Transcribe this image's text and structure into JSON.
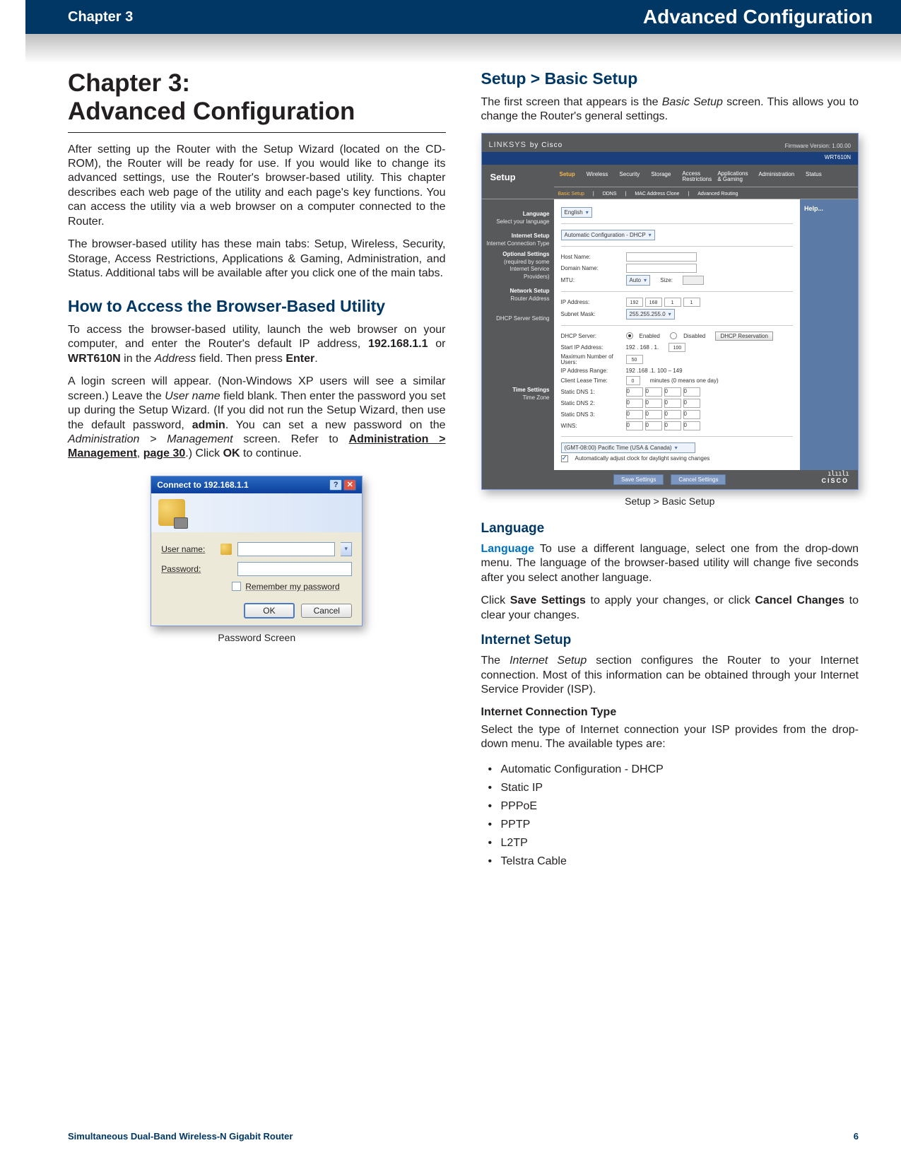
{
  "header": {
    "chapter_label": "Chapter 3",
    "section_title": "Advanced Configuration"
  },
  "left": {
    "title": "Chapter 3:\nAdvanced Configuration",
    "p1": "After setting up the Router with the Setup Wizard (located on the CD-ROM), the Router will be ready for use. If you would like to change its advanced settings, use the Router's browser-based utility. This chapter describes each web page of the utility and each page's key functions. You can access the utility via a web browser on a computer connected to the Router.",
    "p2": "The browser-based utility has these main tabs: Setup, Wireless, Security, Storage, Access Restrictions, Applications & Gaming, Administration, and Status. Additional tabs will be available after you click one of the main tabs.",
    "h_access": "How to Access the Browser-Based Utility",
    "p3_a": "To access the browser-based utility, launch the web browser on your computer, and enter the Router's default IP address, ",
    "p3_ip": "192.168.1.1",
    "p3_or": " or ",
    "p3_model": "WRT610N",
    "p3_b": " in the ",
    "p3_addr": "Address",
    "p3_c": " field. Then press ",
    "p3_enter": "Enter",
    "p3_d": ".",
    "p4_a": "A login screen will appear. (Non-Windows XP users will see a similar screen.) Leave the ",
    "p4_user": "User name",
    "p4_b": " field blank. Then enter the password you set up during the Setup Wizard. (If you did not run the Setup Wizard, then use the default password, ",
    "p4_admin": "admin",
    "p4_c": ". You can set a new password on the ",
    "p4_adminmgmt": "Administration > Management",
    "p4_d": " screen. Refer to ",
    "p4_link": "Administration > Management",
    "p4_e": ", ",
    "p4_page": "page 30",
    "p4_f": ".) Click ",
    "p4_ok": "OK",
    "p4_g": " to continue.",
    "pw_title": "Connect to 192.168.1.1",
    "pw_user_label": "User name:",
    "pw_pass_label": "Password:",
    "pw_remember": "Remember my password",
    "pw_ok": "OK",
    "pw_cancel": "Cancel",
    "pw_caption": "Password Screen"
  },
  "right": {
    "h_setup": "Setup > Basic Setup",
    "p_setup_a": "The first screen that appears is the ",
    "p_setup_i": "Basic Setup",
    "p_setup_b": " screen. This allows you to change the Router's general settings.",
    "rs": {
      "logo": "LINKSYS",
      "by": "by Cisco",
      "fw": "Firmware Version: 1.00.00",
      "model_line": "WRT610N",
      "setup": "Setup",
      "tabs": [
        "Setup",
        "Wireless",
        "Security",
        "Storage",
        "Access Restrictions",
        "Applications & Gaming",
        "Administration",
        "Status"
      ],
      "subtabs": [
        "Basic Setup",
        "DDNS",
        "MAC Address Clone",
        "Advanced Routing"
      ],
      "side": {
        "lang_h": "Language",
        "lang_t": "Select your language",
        "inet_h": "Internet Setup",
        "inet_t": "Internet Connection Type",
        "opt_h": "Optional Settings",
        "opt_t": "(required by some Internet Service Providers)",
        "net_h": "Network Setup",
        "net_t": "Router Address",
        "dhcp_t": "DHCP Server Setting",
        "time_h": "Time Settings",
        "time_t": "Time Zone"
      },
      "fields": {
        "lang_sel": "English",
        "ict_sel": "Automatic Configuration - DHCP",
        "hostname": "Host Name:",
        "domain": "Domain Name:",
        "mtu": "MTU:",
        "mtu_sel": "Auto",
        "mtu_size_lbl": "Size:",
        "ip_lbl": "IP Address:",
        "ip": [
          "192",
          "168",
          "1",
          "1"
        ],
        "mask_lbl": "Subnet Mask:",
        "mask": "255.255.255.0",
        "dhcp_lbl": "DHCP Server:",
        "dhcp_en": "Enabled",
        "dhcp_dis": "Disabled",
        "dhcp_res": "DHCP Reservation",
        "start_lbl": "Start IP Address:",
        "start_pre": "192 . 168 . 1.",
        "start_val": "100",
        "maxu_lbl": "Maximum Number of Users:",
        "maxu_val": "50",
        "range_lbl": "IP Address Range:",
        "range_val": "192 .168 .1. 100 – 149",
        "lease_lbl": "Client Lease Time:",
        "lease_val": "0",
        "lease_unit": "minutes (0 means one day)",
        "dns1": "Static DNS 1:",
        "dns2": "Static DNS 2:",
        "dns3": "Static DNS 3:",
        "wins": "WINS:",
        "tz_sel": "(GMT-08:00) Pacific Time (USA & Canada)",
        "tz_chk": "Automatically adjust clock for daylight saving changes",
        "save": "Save Settings",
        "cancel": "Cancel Settings",
        "help": "Help...",
        "cisco": "CISCO"
      }
    },
    "caption_setup": "Setup > Basic Setup",
    "h_lang": "Language",
    "lang_runin": "Language",
    "p_lang": "  To use a different language, select one from the drop-down menu. The language of the browser-based utility will change five seconds after you select another language.",
    "p_save_a": "Click ",
    "p_save_b": "Save Settings",
    "p_save_c": " to apply your changes, or click ",
    "p_save_d": "Cancel Changes",
    "p_save_e": " to clear your changes.",
    "h_inet": "Internet Setup",
    "p_inet_a": "The ",
    "p_inet_i": "Internet Setup",
    "p_inet_b": " section configures the Router to your Internet connection. Most of this information can be obtained through your Internet Service Provider (ISP).",
    "h_ict": "Internet Connection Type",
    "p_ict": "Select the type of Internet connection your ISP provides from the drop-down menu. The available types are:",
    "types": [
      "Automatic Configuration - DHCP",
      "Static IP",
      "PPPoE",
      "PPTP",
      "L2TP",
      "Telstra Cable"
    ]
  },
  "footer": {
    "product": "Simultaneous Dual-Band Wireless-N Gigabit Router",
    "page": "6"
  }
}
